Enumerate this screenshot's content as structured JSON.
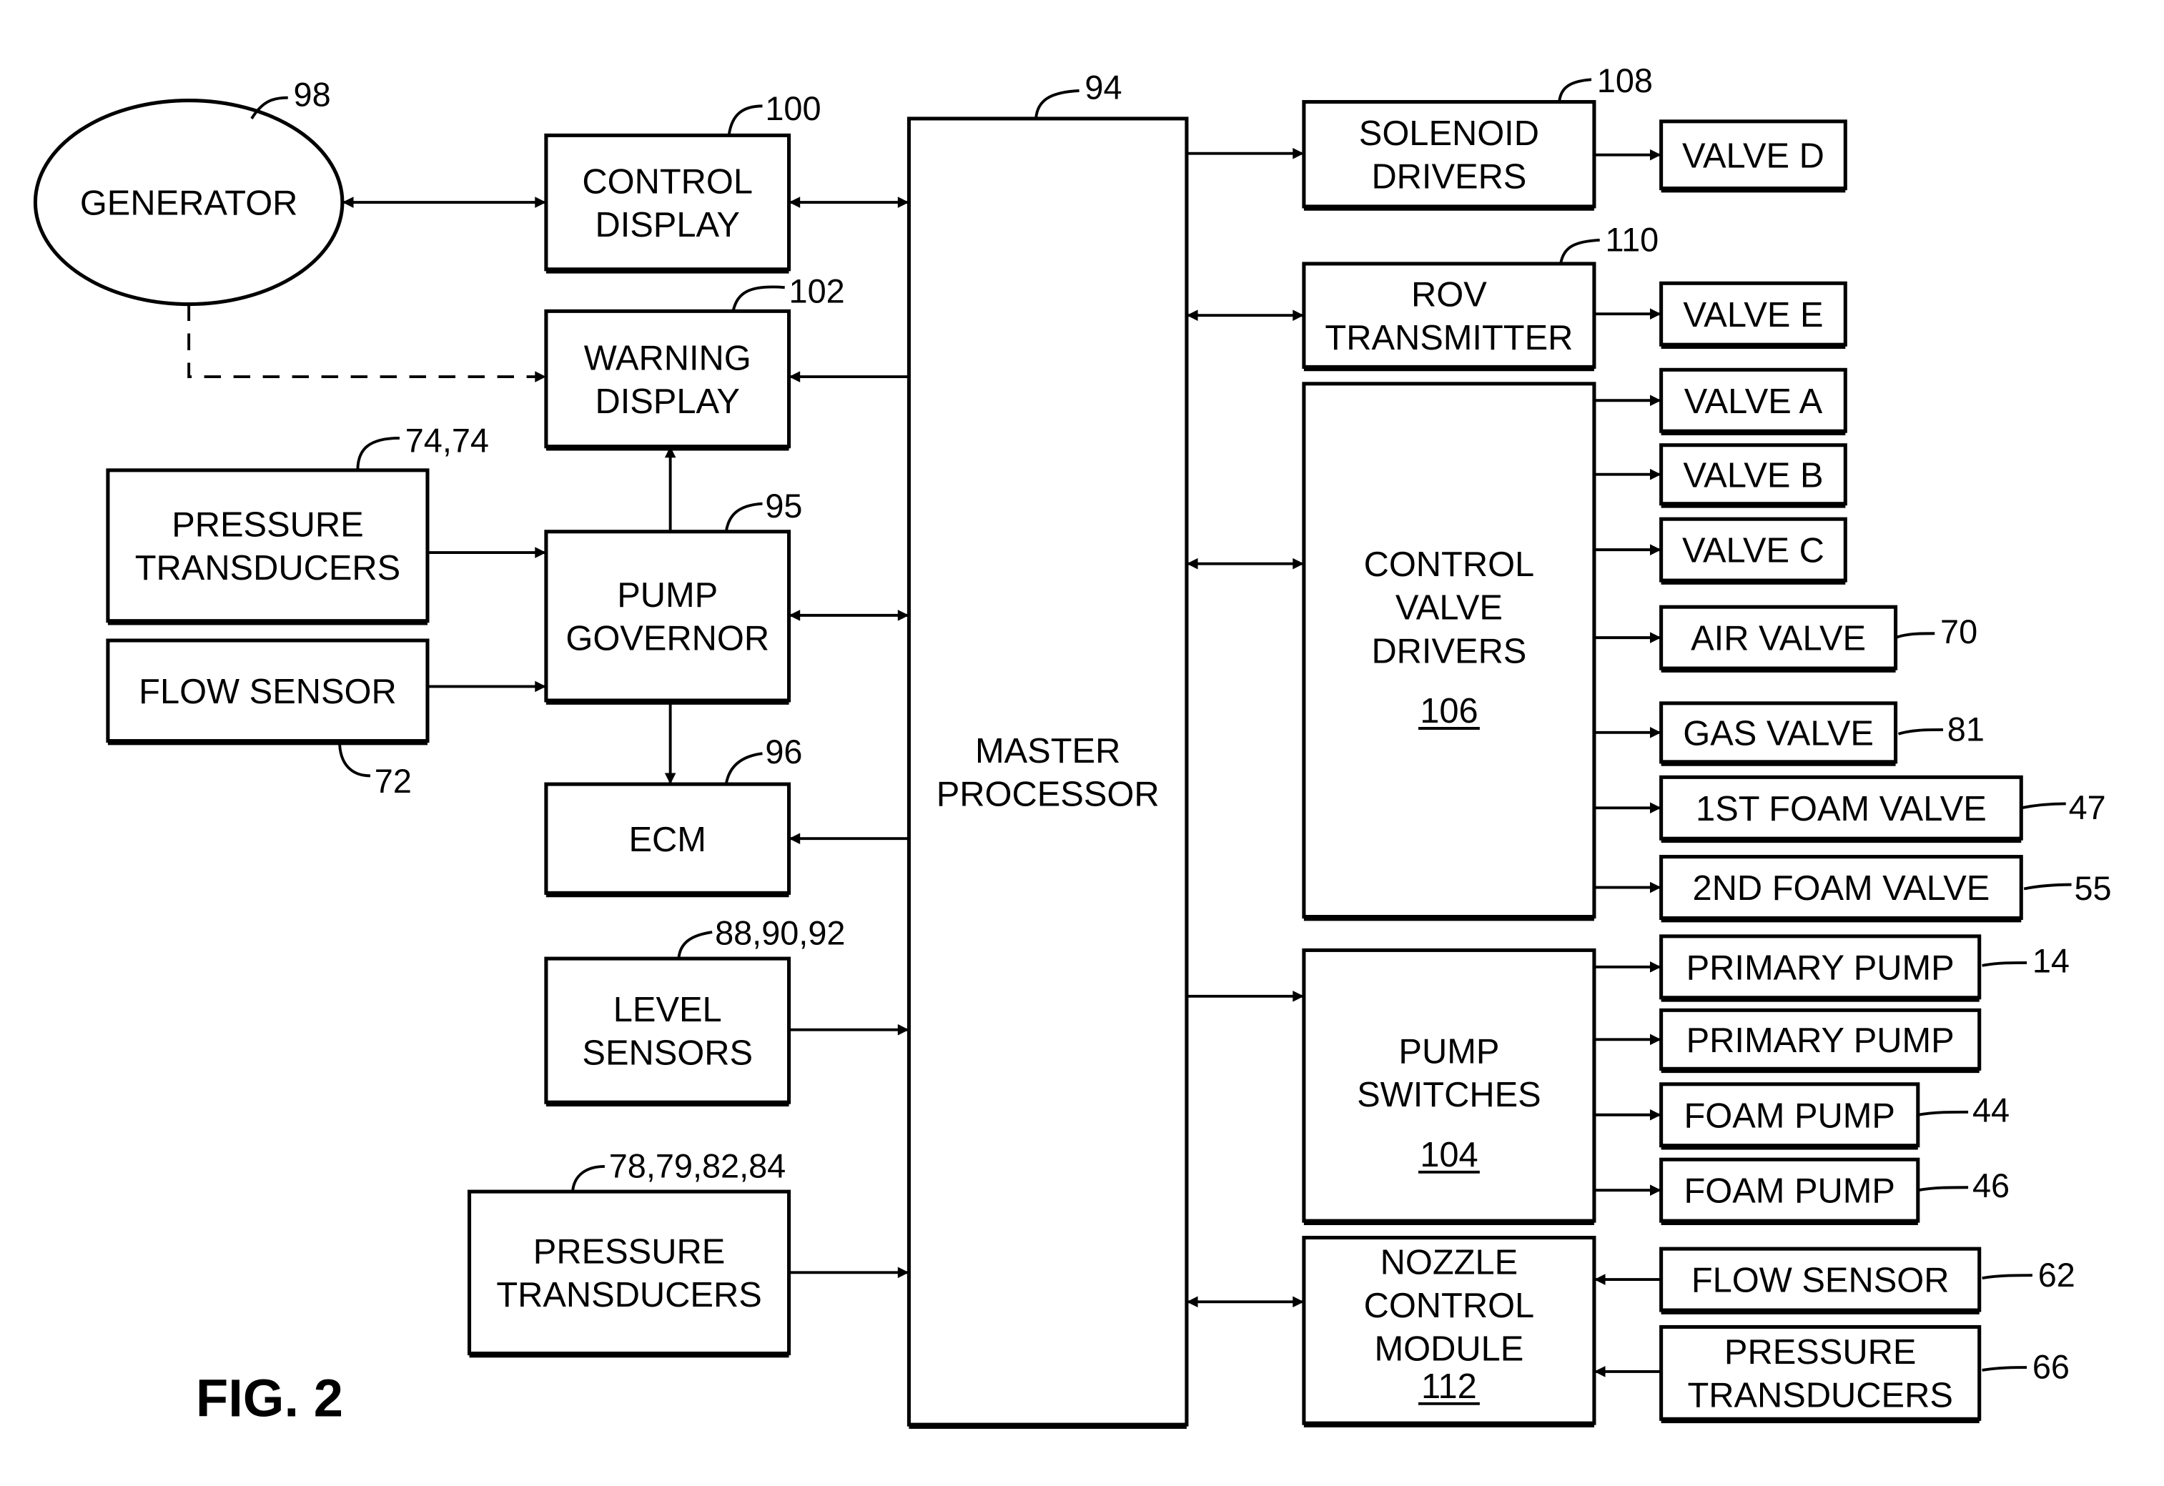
{
  "figure_label": "FIG. 2",
  "colors": {
    "ink": "#000000",
    "paper": "#ffffff"
  },
  "nodes": {
    "generator": {
      "lines": [
        "GENERATOR"
      ],
      "ref": "98"
    },
    "control_display": {
      "lines": [
        "CONTROL",
        "DISPLAY"
      ],
      "ref": "100"
    },
    "warning_display": {
      "lines": [
        "WARNING",
        "DISPLAY"
      ],
      "ref": "102"
    },
    "pressure_transducers_left": {
      "lines": [
        "PRESSURE",
        "TRANSDUCERS"
      ],
      "ref": "74,74"
    },
    "flow_sensor_left": {
      "lines": [
        "FLOW SENSOR"
      ],
      "ref": "72"
    },
    "pump_governor": {
      "lines": [
        "PUMP",
        "GOVERNOR"
      ],
      "ref": "95"
    },
    "ecm": {
      "lines": [
        "ECM"
      ],
      "ref": "96"
    },
    "level_sensors": {
      "lines": [
        "LEVEL",
        "SENSORS"
      ],
      "ref": "88,90,92"
    },
    "pressure_transducers_bottom": {
      "lines": [
        "PRESSURE",
        "TRANSDUCERS"
      ],
      "ref": "78,79,82,84"
    },
    "master_processor": {
      "lines": [
        "MASTER",
        "PROCESSOR"
      ],
      "ref": "94"
    },
    "solenoid_drivers": {
      "lines": [
        "SOLENOID",
        "DRIVERS"
      ],
      "ref": "108"
    },
    "rov_transmitter": {
      "lines": [
        "ROV",
        "TRANSMITTER"
      ],
      "ref": "110"
    },
    "control_valve_drivers": {
      "lines": [
        "CONTROL",
        "VALVE",
        "DRIVERS"
      ],
      "ref": "106"
    },
    "pump_switches": {
      "lines": [
        "PUMP",
        "SWITCHES"
      ],
      "ref": "104"
    },
    "nozzle_control_module": {
      "lines": [
        "NOZZLE",
        "CONTROL",
        "MODULE"
      ],
      "ref": "112"
    },
    "valve_d": {
      "lines": [
        "VALVE D"
      ]
    },
    "valve_e": {
      "lines": [
        "VALVE E"
      ]
    },
    "valve_a": {
      "lines": [
        "VALVE A"
      ]
    },
    "valve_b": {
      "lines": [
        "VALVE B"
      ]
    },
    "valve_c": {
      "lines": [
        "VALVE C"
      ]
    },
    "air_valve": {
      "lines": [
        "AIR VALVE"
      ],
      "ref": "70"
    },
    "gas_valve": {
      "lines": [
        "GAS VALVE"
      ],
      "ref": "81"
    },
    "first_foam_valve": {
      "lines": [
        "1ST FOAM VALVE"
      ],
      "ref": "47"
    },
    "second_foam_valve": {
      "lines": [
        "2ND FOAM VALVE"
      ],
      "ref": "55"
    },
    "primary_pump_1": {
      "lines": [
        "PRIMARY PUMP"
      ],
      "ref": "14"
    },
    "primary_pump_2": {
      "lines": [
        "PRIMARY PUMP"
      ]
    },
    "foam_pump_1": {
      "lines": [
        "FOAM PUMP"
      ],
      "ref": "44"
    },
    "foam_pump_2": {
      "lines": [
        "FOAM PUMP"
      ],
      "ref": "46"
    },
    "flow_sensor_right": {
      "lines": [
        "FLOW SENSOR"
      ],
      "ref": "62"
    },
    "pressure_transducers_right": {
      "lines": [
        "PRESSURE",
        "TRANSDUCERS"
      ],
      "ref": "66"
    }
  },
  "connections": [
    {
      "from": "generator",
      "to": "control_display",
      "type": "bidirectional"
    },
    {
      "from": "generator",
      "to": "warning_display",
      "type": "dashed"
    },
    {
      "from": "control_display",
      "to": "master_processor",
      "type": "bidirectional"
    },
    {
      "from": "master_processor",
      "to": "warning_display",
      "type": "directed"
    },
    {
      "from": "pump_governor",
      "to": "warning_display",
      "type": "directed"
    },
    {
      "from": "pressure_transducers_left",
      "to": "pump_governor",
      "type": "directed"
    },
    {
      "from": "flow_sensor_left",
      "to": "pump_governor",
      "type": "directed"
    },
    {
      "from": "pump_governor",
      "to": "master_processor",
      "type": "bidirectional"
    },
    {
      "from": "pump_governor",
      "to": "ecm",
      "type": "directed"
    },
    {
      "from": "master_processor",
      "to": "ecm",
      "type": "directed"
    },
    {
      "from": "level_sensors",
      "to": "master_processor",
      "type": "directed"
    },
    {
      "from": "pressure_transducers_bottom",
      "to": "master_processor",
      "type": "directed"
    },
    {
      "from": "master_processor",
      "to": "solenoid_drivers",
      "type": "directed"
    },
    {
      "from": "master_processor",
      "to": "rov_transmitter",
      "type": "bidirectional"
    },
    {
      "from": "master_processor",
      "to": "control_valve_drivers",
      "type": "bidirectional"
    },
    {
      "from": "master_processor",
      "to": "pump_switches",
      "type": "directed"
    },
    {
      "from": "master_processor",
      "to": "nozzle_control_module",
      "type": "bidirectional"
    },
    {
      "from": "solenoid_drivers",
      "to": "valve_d",
      "type": "directed"
    },
    {
      "from": "rov_transmitter",
      "to": "valve_e",
      "type": "directed"
    },
    {
      "from": "control_valve_drivers",
      "to": "valve_a",
      "type": "directed"
    },
    {
      "from": "control_valve_drivers",
      "to": "valve_b",
      "type": "directed"
    },
    {
      "from": "control_valve_drivers",
      "to": "valve_c",
      "type": "directed"
    },
    {
      "from": "control_valve_drivers",
      "to": "air_valve",
      "type": "directed"
    },
    {
      "from": "control_valve_drivers",
      "to": "gas_valve",
      "type": "directed"
    },
    {
      "from": "control_valve_drivers",
      "to": "first_foam_valve",
      "type": "directed"
    },
    {
      "from": "control_valve_drivers",
      "to": "second_foam_valve",
      "type": "directed"
    },
    {
      "from": "pump_switches",
      "to": "primary_pump_1",
      "type": "directed"
    },
    {
      "from": "pump_switches",
      "to": "primary_pump_2",
      "type": "directed"
    },
    {
      "from": "pump_switches",
      "to": "foam_pump_1",
      "type": "directed"
    },
    {
      "from": "pump_switches",
      "to": "foam_pump_2",
      "type": "directed"
    },
    {
      "from": "flow_sensor_right",
      "to": "nozzle_control_module",
      "type": "directed"
    },
    {
      "from": "pressure_transducers_right",
      "to": "nozzle_control_module",
      "type": "directed"
    }
  ]
}
